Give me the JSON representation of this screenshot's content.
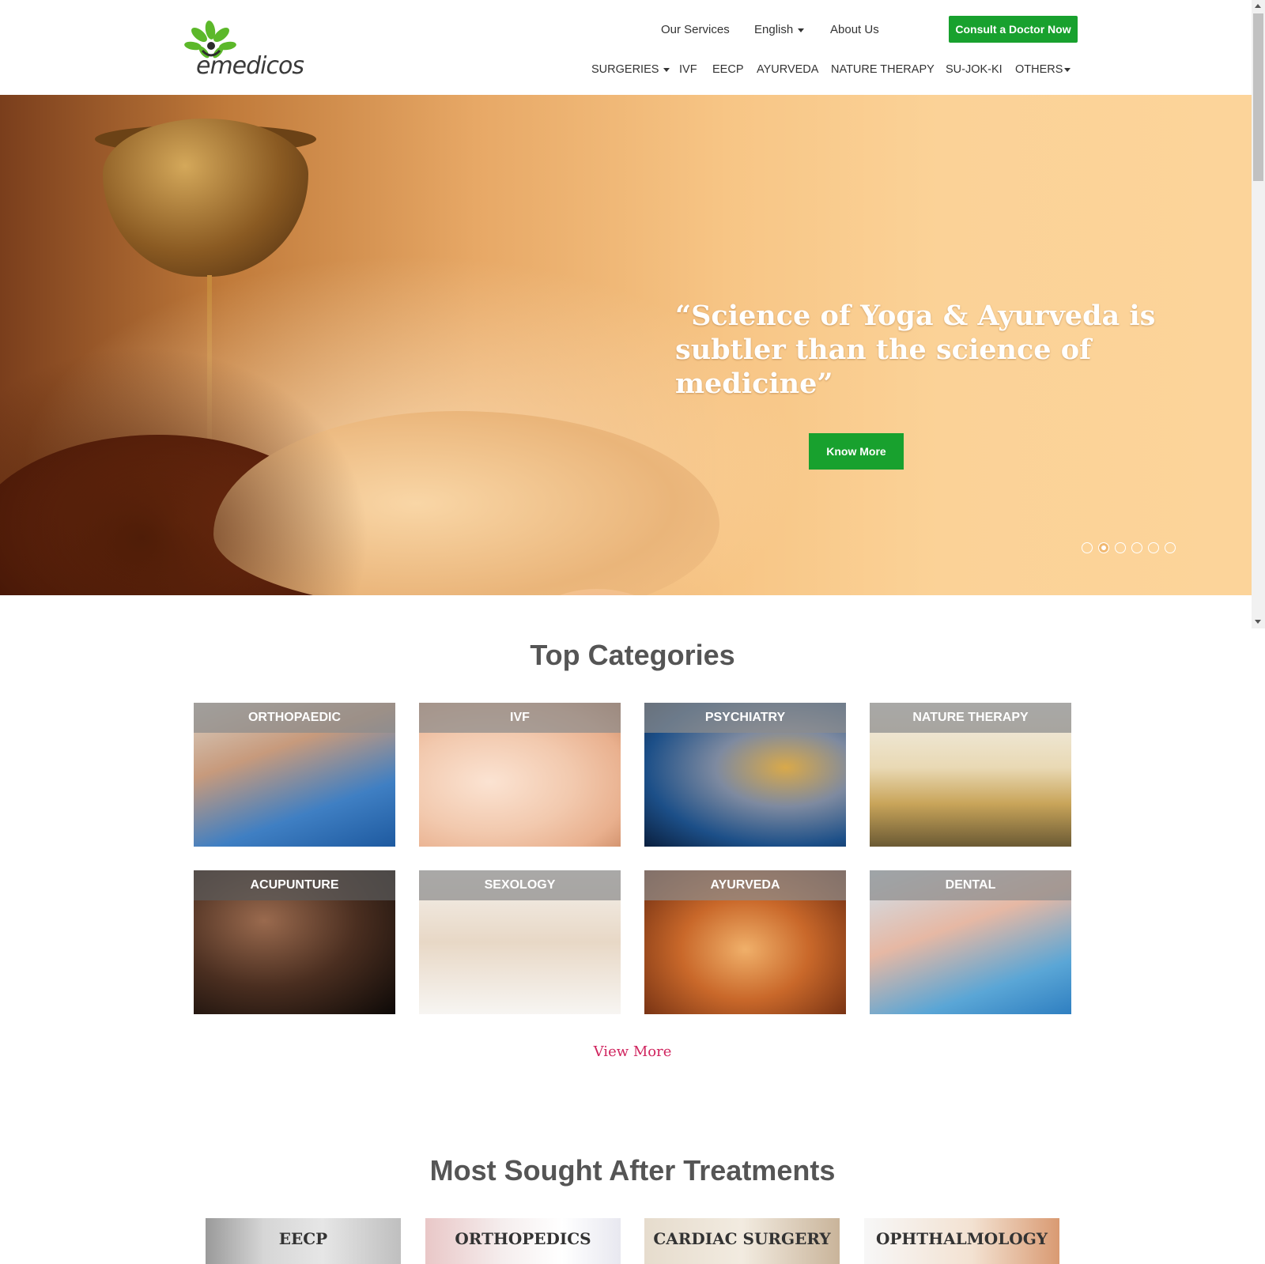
{
  "header": {
    "logo_text": "emedicos",
    "top_nav": {
      "services": "Our Services",
      "language": "English",
      "about": "About Us",
      "consult": "Consult a Doctor Now"
    },
    "main_nav": [
      "SURGERIES",
      "IVF",
      "EECP",
      "AYURVEDA",
      "NATURE THERAPY",
      "SU-JOK-KI",
      "OTHERS"
    ]
  },
  "hero": {
    "quote_line1": "“Science of Yoga & Ayurveda is",
    "quote_line2": "subtler than the science of medicine”",
    "cta": "Know More",
    "slides_total": 6,
    "active_slide": 2
  },
  "categories": {
    "title": "Top Categories",
    "items": [
      "ORTHOPAEDIC",
      "IVF",
      "PSYCHIATRY",
      "NATURE THERAPY",
      "ACUPUNTURE",
      "SEXOLOGY",
      "AYURVEDA",
      "DENTAL"
    ],
    "view_more": "View More"
  },
  "treatments": {
    "title": "Most Sought After Treatments",
    "items": [
      "EECP",
      "ORTHOPEDICS",
      "CARDIAC SURGERY",
      "OPHTHALMOLOGY"
    ]
  },
  "colors": {
    "brand_green": "#18a12e",
    "link_pink": "#d0245e",
    "title_gray": "#555555"
  }
}
